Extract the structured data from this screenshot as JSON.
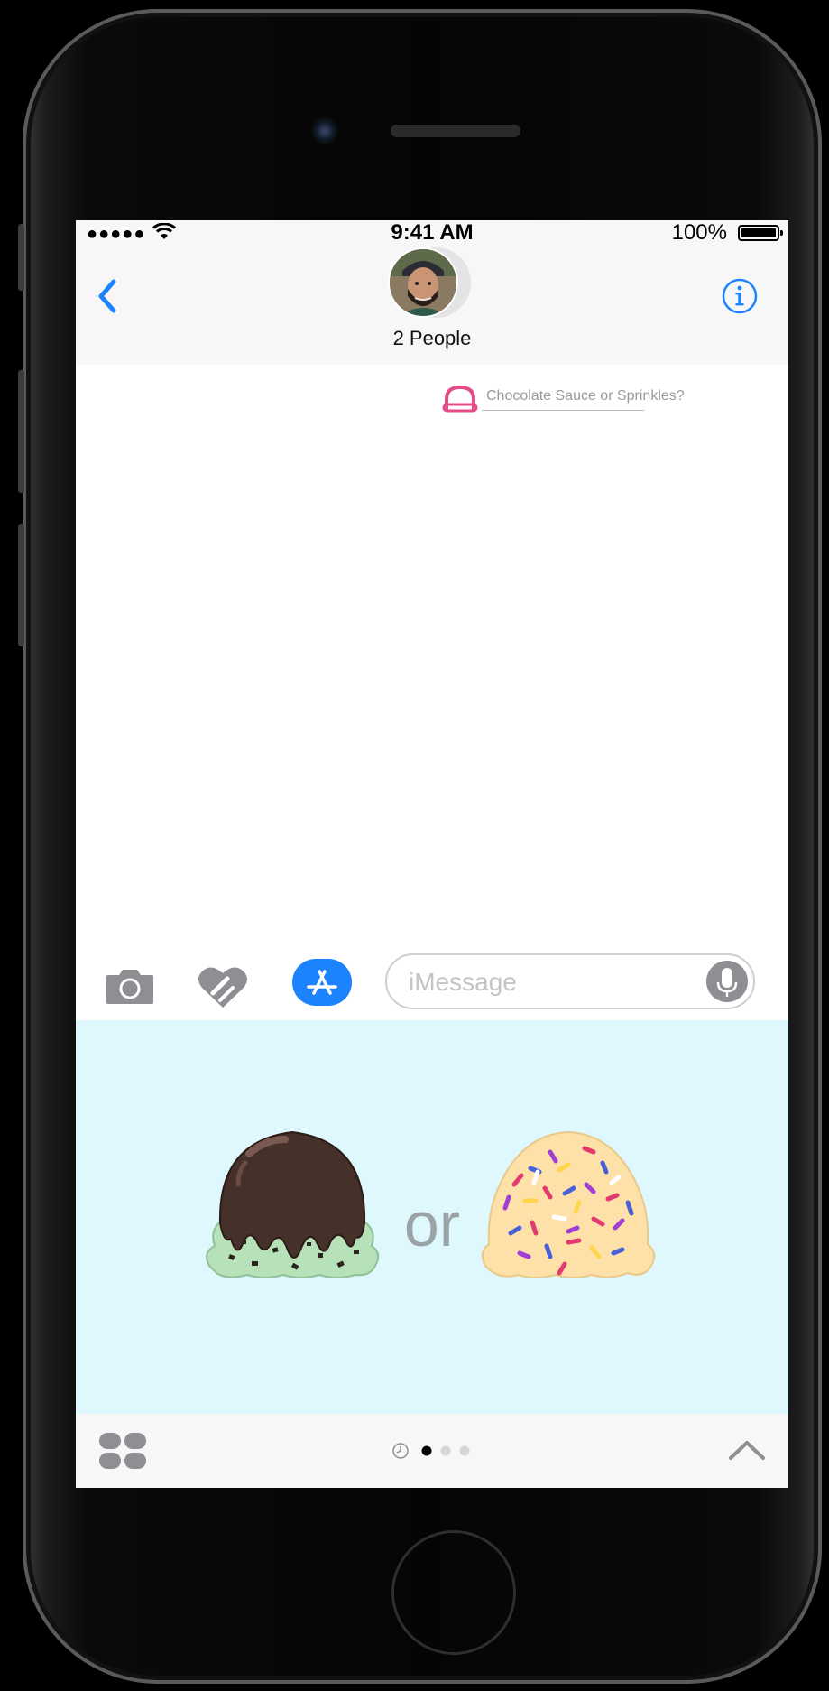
{
  "status": {
    "signal": "●●●●●",
    "time": "9:41 AM",
    "battery": "100%"
  },
  "header": {
    "title": "2 People"
  },
  "conversation": {
    "message": "Chocolate Sauce or Sprinkles?"
  },
  "composer": {
    "placeholder": "iMessage"
  },
  "app_panel": {
    "separator": "or",
    "options": [
      "Chocolate Sauce",
      "Sprinkles"
    ]
  },
  "page_indicator": {
    "pages": 3,
    "active": 1
  },
  "colors": {
    "accent": "#1c83fc",
    "panel_bg": "#dff8fd",
    "message_icon": "#e54b87"
  }
}
